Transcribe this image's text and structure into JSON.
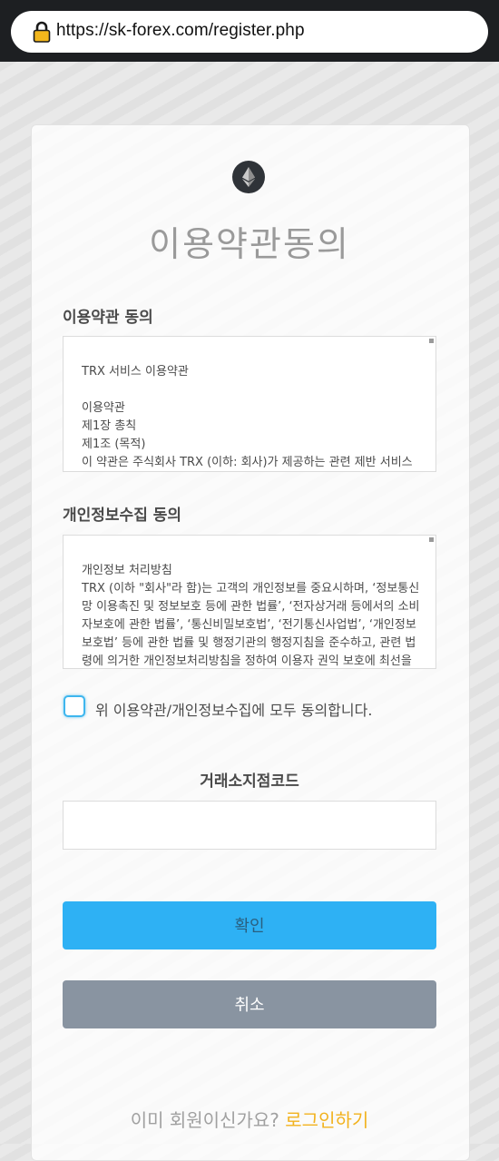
{
  "browser": {
    "url": "https://sk-forex.com/register.php"
  },
  "page": {
    "title": "이용약관동의"
  },
  "terms": {
    "label": "이용약관 동의",
    "content": "TRX 서비스 이용약관\n\n이용약관\n제1장 총칙\n제1조 (목적)\n이 약관은 주식회사 TRX (이하: 회사)가 제공하는 관련 제반 서비스(이하: 서비스)의 이용조건 및 절차에 관한 회사와 회원 간의 권리, 의무 및 책임사항 등을 규정함을 목적으로 합니다."
  },
  "privacy": {
    "label": "개인정보수집 동의",
    "content": "개인정보 처리방침\nTRX (이하 \"회사\"라 함)는 고객의 개인정보를 중요시하며, ‘정보통신망 이용촉진 및 정보보호 등에 관한 법률’, ‘전자상거래 등에서의 소비자보호에 관한 법률’, ‘통신비밀보호법’, ‘전기통신사업법’, ‘개인정보보호법’ 등에 관한 법률 및 행정기관의 행정지침을 준수하고, 관련 법령에 의거한 개인정보처리방침을 정하여 이용자 권익 보호에 최선을 다하고 있습니다. “회사”의 개인정보처리방침은 개인정보의 수집·이용 목적 등을 포함합니다."
  },
  "agree": {
    "label": "위 이용약관/개인정보수집에 모두 동의합니다.",
    "checked": false
  },
  "store_code": {
    "label": "거래소지점코드",
    "value": "",
    "placeholder": ""
  },
  "buttons": {
    "confirm": "확인",
    "cancel": "취소"
  },
  "login": {
    "prompt": "이미 회원이신가요?",
    "link": "로그인하기"
  },
  "colors": {
    "confirm_bg": "#2eb1f4",
    "cancel_bg": "#8994a1",
    "login_link": "#f2b21e",
    "checkbox_border": "#3eb6ee"
  },
  "icons": {
    "lock": "lock-icon",
    "logo": "ethereum-logo-icon"
  }
}
